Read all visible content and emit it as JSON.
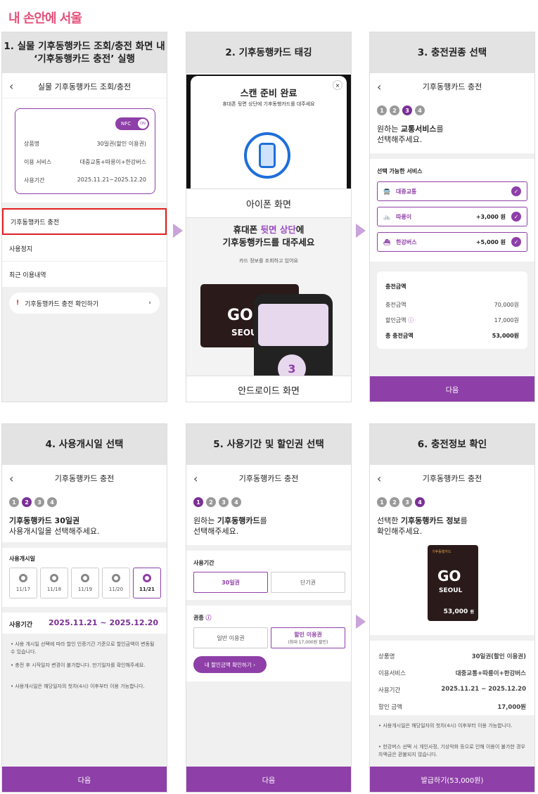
{
  "logo": "내 손안에 서울",
  "p1": {
    "title1": "1. 실물 기후동행카드 조회/충전 화면 내",
    "title2": "‘기후동행카드 충전’ 실행",
    "nav": "실물 기후동행카드 조회/충전",
    "nfc": "NFC",
    "on": "ON",
    "rows": [
      {
        "k": "상품명",
        "v": "30일권(할인 이용권)"
      },
      {
        "k": "이용 서비스",
        "v": "대중교통+따릉이+한강버스"
      },
      {
        "k": "사용기간",
        "v": "2025.11.21~2025.12.20"
      }
    ],
    "menu1": "기후동행카드 충전",
    "menu2": "사용정지",
    "menu3": "최근 이용내역",
    "confirm": "기후동행카드 충전 확인하기"
  },
  "p2": {
    "title": "2. 기후동행카드 태깅",
    "scan": "스캔 준비 완료",
    "scan_sub": "휴대폰 뒷면 상단에 기후동행카드를 대주세요",
    "iphone": "아이폰 화면",
    "tag1a": "휴대폰 ",
    "tag1b": "뒷면 상단",
    "tag1c": "에",
    "tag2": "기후동행카드를 대주세요",
    "reading": "카드 정보를 조회하고 있어요",
    "android": "안드로이드 화면",
    "cardbrand": "SEOUL",
    "countdown": "3"
  },
  "p3": {
    "title": "3. 충전권종 선택",
    "nav": "기후동행카드 충전",
    "q1a": "원하는 ",
    "q1b": "교통서비스",
    "q1c": "를",
    "q2": "선택해주세요.",
    "avail": "선택 가능한 서비스",
    "svc": [
      {
        "name": "대중교통",
        "amt": ""
      },
      {
        "name": "따릉이",
        "amt": "+3,000 원"
      },
      {
        "name": "한강버스",
        "amt": "+5,000 원"
      }
    ],
    "sum_title": "충전금액",
    "sum": [
      {
        "k": "충전금액",
        "v": "70,000원"
      },
      {
        "k": "할인금액",
        "v": "17,000원"
      },
      {
        "k": "총 충전금액",
        "v": "53,000원"
      }
    ],
    "next": "다음"
  },
  "p4": {
    "title": "4. 사용개시일 선택",
    "nav": "기후동행카드 충전",
    "q1": "기후동행카드 30일권",
    "q2": "사용개시일을 선택해주세요.",
    "label": "사용개시일",
    "dates": [
      "11/17",
      "11/18",
      "11/19",
      "11/20",
      "11/21"
    ],
    "period_label": "사용기간",
    "period": "2025.11.21 ~ 2025.12.20",
    "notes": [
      "사용 개시일 선택에 따라 할인 인증기간 기준으로 할인금액이 변동될 수 있습니다.",
      "충전 후 시작일자 변경이 불가합니다. 만기일자를 확인해주세요.",
      "사용개시일은 해당일자의 첫차(4시) 이후부터 이용 가능합니다."
    ],
    "next": "다음"
  },
  "p5": {
    "title": "5. 사용기간 및 할인권 선택",
    "nav": "기후동행카드 충전",
    "q1a": "원하는 ",
    "q1b": "기후동행카드",
    "q1c": "를",
    "q2": "선택해주세요.",
    "period_label": "사용기간",
    "t30": "30일권",
    "tshort": "단기권",
    "kind_label": "권종",
    "normal": "일반 이용권",
    "disc": "할인 이용권",
    "disc_sub": "(최대 17,000원 할인)",
    "check": "내 할인금액 확인하기",
    "next": "다음"
  },
  "p6": {
    "title": "6. 충전정보 확인",
    "nav": "기후동행카드 충전",
    "q1a": "선택한 ",
    "q1b": "기후동행카드 정보",
    "q1c": "를",
    "q2": "확인해주세요.",
    "card_amt": "53,000",
    "card_won": "원",
    "card_top": "기후동행카드",
    "card_brand": "SEOUL",
    "rows": [
      {
        "k": "상품명",
        "v": "30일권(할인 이용권)"
      },
      {
        "k": "이용서비스",
        "v": "대중교통+따릉이+한강버스"
      },
      {
        "k": "사용기간",
        "v": "2025.11.21 ~ 2025.12.20"
      },
      {
        "k": "할인 금액",
        "v": "17,000원"
      }
    ],
    "notes": [
      "사용개시일은 해당일자의 첫차(4시) 이후부터 이용 가능합니다.",
      "한강버스 선택 시 개인사정, 기상악화 등으로 인해 이용이 불가한 경우 차액금은 환불되지 않습니다."
    ],
    "pay": "발급하기(53,000원)"
  }
}
